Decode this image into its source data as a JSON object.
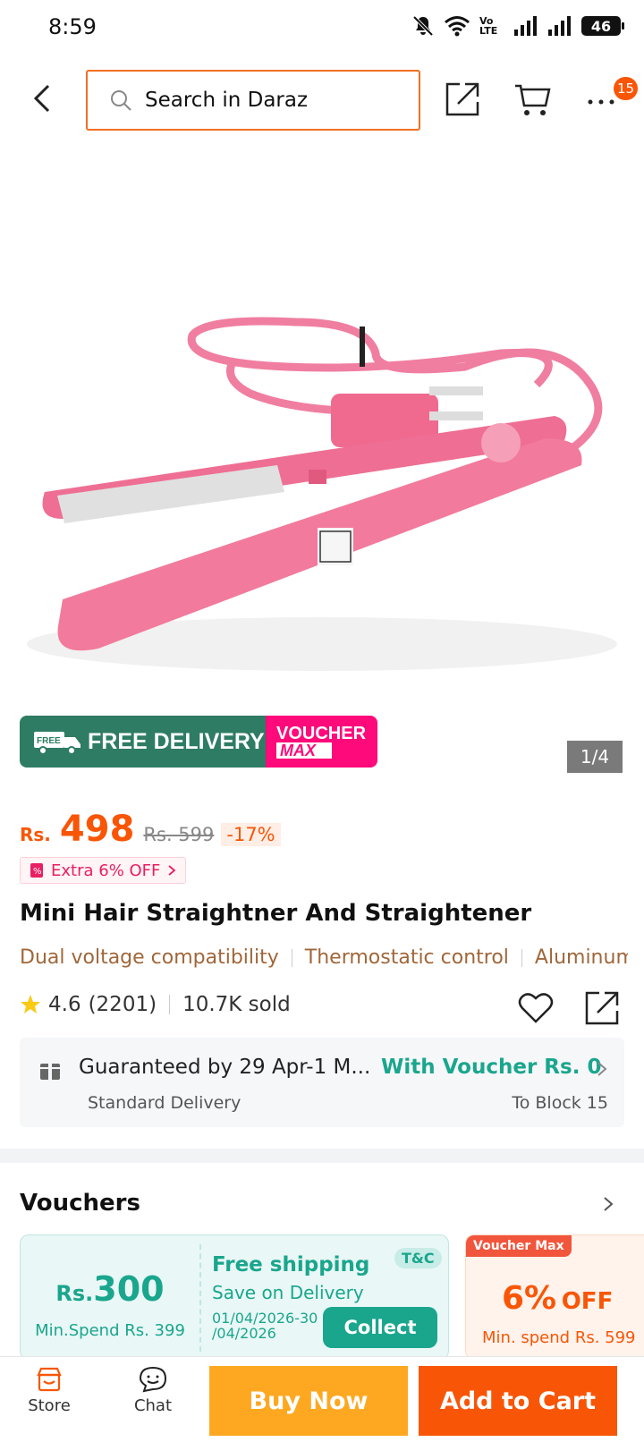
{
  "status": {
    "time": "8:59",
    "lte": "Vo LTE",
    "battery": "46"
  },
  "header": {
    "search_placeholder": "Search in Daraz",
    "cart_badge": "15"
  },
  "gallery": {
    "counter": "1/4",
    "banner_left": "FREE DELIVERY",
    "banner_free_tag": "FREE",
    "banner_right_1": "VOUCHER",
    "banner_right_2": "MAX"
  },
  "price": {
    "currency": "Rs.",
    "current": "498",
    "original": "Rs. 599",
    "discount": "-17%",
    "extra": "Extra 6% OFF"
  },
  "product": {
    "title": "Mini Hair Straightner And Straightener",
    "features": [
      "Dual voltage compatibility",
      "Thermostatic control",
      "Aluminum"
    ],
    "rating": "4.6",
    "reviews": "(2201)",
    "sold": "10.7K sold"
  },
  "delivery": {
    "guarantee": "Guaranteed by 29 Apr-1 M...",
    "voucher": "With Voucher Rs. 0",
    "method": "Standard Delivery",
    "location": "To Block 15"
  },
  "vouchers": {
    "title": "Vouchers",
    "card1": {
      "rs": "Rs.",
      "amount": "300",
      "min_spend": "Min.Spend Rs. 399",
      "title": "Free shipping",
      "subtitle": "Save on Delivery",
      "date": "01/04/2026-30 /04/2026",
      "tc": "T&C",
      "collect": "Collect"
    },
    "card2": {
      "tag": "Voucher Max",
      "off_big": "6%",
      "off_small": "OFF",
      "min_spend": "Min. spend Rs. 599"
    }
  },
  "bottom": {
    "store": "Store",
    "chat": "Chat",
    "buy_now": "Buy Now",
    "add_to_cart": "Add to Cart"
  },
  "colors": {
    "accent": "#f85606",
    "teal": "#1aa68d",
    "buy_now": "#fea821",
    "free_delivery": "#2e7c63",
    "voucher_max": "#ff0a7a",
    "product": "#f06a90"
  }
}
